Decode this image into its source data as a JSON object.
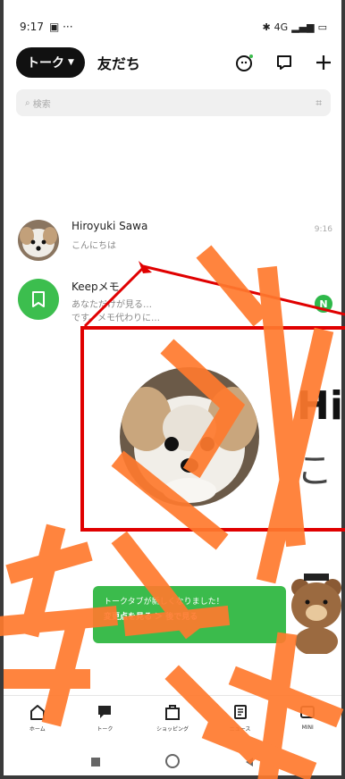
{
  "status_bar": {
    "time": "9:17",
    "icons_right": "4G"
  },
  "header": {
    "talk_tab": "トーク",
    "friends_tab": "友だち"
  },
  "search": {
    "placeholder": "検索"
  },
  "chats": [
    {
      "name": "Hiroyuki Sawa",
      "message": "こんにちは",
      "time": "9:16"
    },
    {
      "name": "Keepメモ",
      "message": "あなただけが見る…",
      "message2": "です。メモ代わりに…",
      "badge": "N"
    }
  ],
  "zoom": {
    "name": "Hi",
    "message": "こ"
  },
  "banner": {
    "line1": "トークタブが新しくなりました！",
    "line2": "変更点を見る ＞ 後で見る"
  },
  "bottom_nav": [
    {
      "label": "ホーム",
      "icon": "home-icon"
    },
    {
      "label": "トーク",
      "icon": "chat-icon"
    },
    {
      "label": "ショッピング",
      "icon": "shopping-icon"
    },
    {
      "label": "ニュース",
      "icon": "news-icon"
    },
    {
      "label": "MINI",
      "icon": "mini-icon"
    }
  ],
  "colors": {
    "accent": "#3bbb4c",
    "annotation_red": "#e00000",
    "annotation_orange": "#ff7a2e"
  }
}
